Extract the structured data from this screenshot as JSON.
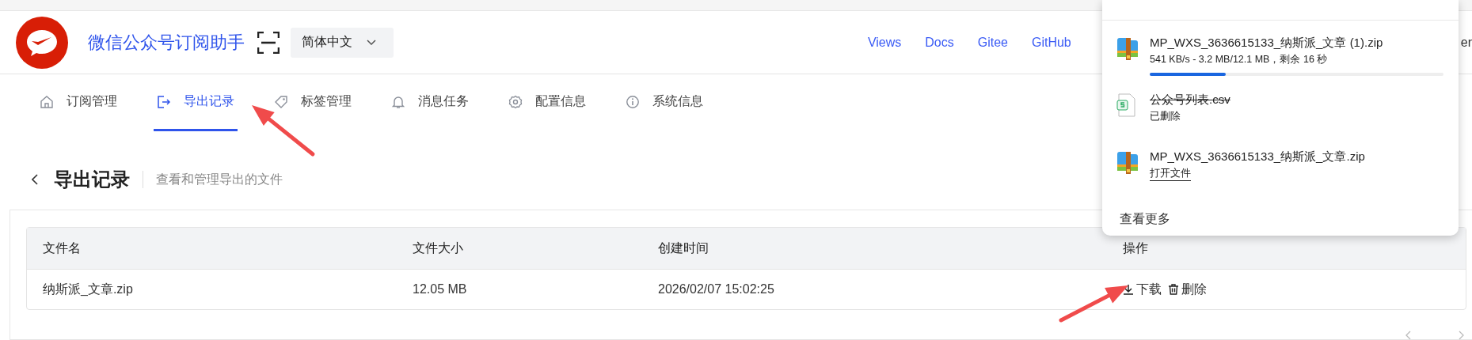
{
  "header": {
    "app_title": "微信公众号订阅助手",
    "language": "简体中文",
    "links": [
      "Views",
      "Docs",
      "Gitee",
      "GitHub",
      "er"
    ]
  },
  "nav_tabs": [
    {
      "label": "订阅管理",
      "selected": false
    },
    {
      "label": "导出记录",
      "selected": true
    },
    {
      "label": "标签管理",
      "selected": false
    },
    {
      "label": "消息任务",
      "selected": false
    },
    {
      "label": "配置信息",
      "selected": false
    },
    {
      "label": "系统信息",
      "selected": false
    }
  ],
  "page": {
    "title": "导出记录",
    "subtitle": "查看和管理导出的文件"
  },
  "table": {
    "columns": [
      "文件名",
      "文件大小",
      "创建时间",
      "操作"
    ],
    "rows": [
      {
        "name": "纳斯派_文章.zip",
        "size": "12.05 MB",
        "created": "2026/02/07 15:02:25",
        "actions": [
          "下载",
          "删除"
        ]
      }
    ]
  },
  "downloads_panel": {
    "items": [
      {
        "kind": "downloading",
        "filename": "MP_WXS_3636615133_纳斯派_文章 (1).zip",
        "status": "541 KB/s - 3.2 MB/12.1 MB，剩余 16 秒",
        "level": 0.26
      },
      {
        "kind": "deleted",
        "filename": "公众号列表.csv",
        "status": "已删除"
      },
      {
        "kind": "complete",
        "filename": "MP_WXS_3636615133_纳斯派_文章.zip",
        "status": "打开文件"
      }
    ],
    "more": "查看更多"
  },
  "annotation_arrows": [
    {
      "kind": "arrow"
    },
    {
      "kind": "arrow"
    }
  ]
}
